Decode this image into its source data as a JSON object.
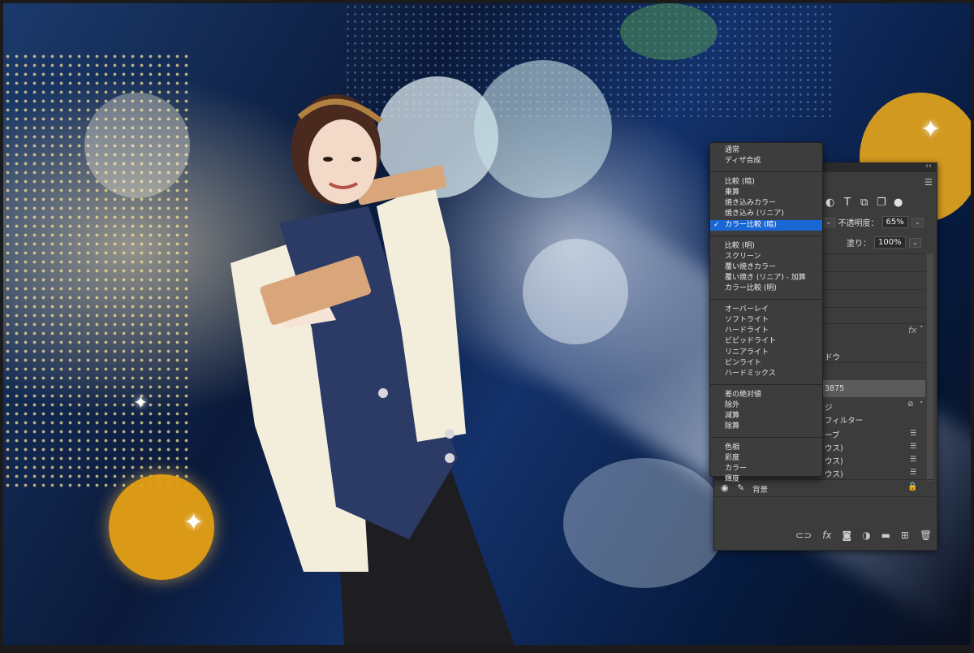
{
  "blend_menu": {
    "groups": [
      [
        "通常",
        "ディザ合成"
      ],
      [
        "比較 (暗)",
        "乗算",
        "焼き込みカラー",
        "焼き込み (リニア)",
        "カラー比較 (暗)"
      ],
      [
        "比較 (明)",
        "スクリーン",
        "覆い焼きカラー",
        "覆い焼き (リニア) - 加算",
        "カラー比較 (明)"
      ],
      [
        "オーバーレイ",
        "ソフトライト",
        "ハードライト",
        "ビビッドライト",
        "リニアライト",
        "ピンライト",
        "ハードミックス"
      ],
      [
        "差の絶対値",
        "除外",
        "減算",
        "除算"
      ],
      [
        "色相",
        "彩度",
        "カラー",
        "輝度"
      ]
    ],
    "selected": "カラー比較 (暗)"
  },
  "layers_panel": {
    "opacity_label": "不透明度：",
    "opacity_value": "65%",
    "fill_label": "塗り：",
    "fill_value": "100%",
    "fx_label": "fx",
    "partial_rows": {
      "shadow": "ドウ",
      "selected_layer": "3875",
      "smart_object": "ジ",
      "smart_filter": "フィルター",
      "curve": "ーブ",
      "blur1": "ウス)",
      "blur2": "ウス)",
      "blur3": "ウス)"
    },
    "background_layer": "背景"
  },
  "colors": {
    "panel_bg": "#3c3c3c",
    "menu_bg": "#3d3d3d",
    "selection": "#1967d2"
  }
}
